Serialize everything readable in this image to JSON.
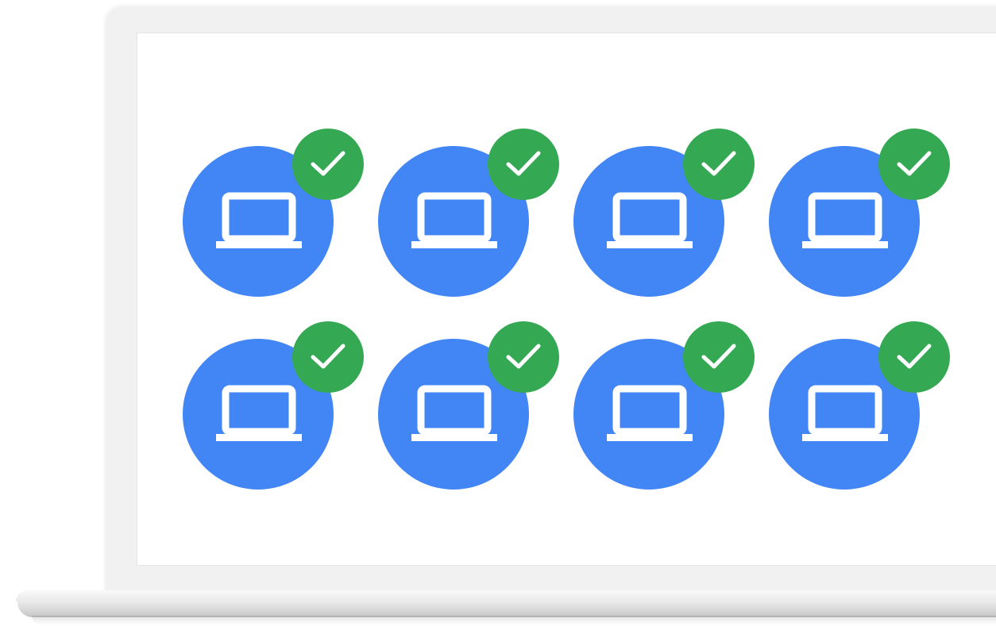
{
  "colors": {
    "device_circle": "#4285f4",
    "check_badge": "#34a853",
    "icon": "#ffffff",
    "laptop_frame": "#f1f1f1"
  },
  "icons": {
    "device": "laptop-icon",
    "badge": "check-icon"
  },
  "grid": {
    "rows": 2,
    "columns": 4,
    "devices": [
      {
        "status": "verified"
      },
      {
        "status": "verified"
      },
      {
        "status": "verified"
      },
      {
        "status": "verified"
      },
      {
        "status": "verified"
      },
      {
        "status": "verified"
      },
      {
        "status": "verified"
      },
      {
        "status": "verified"
      }
    ]
  }
}
